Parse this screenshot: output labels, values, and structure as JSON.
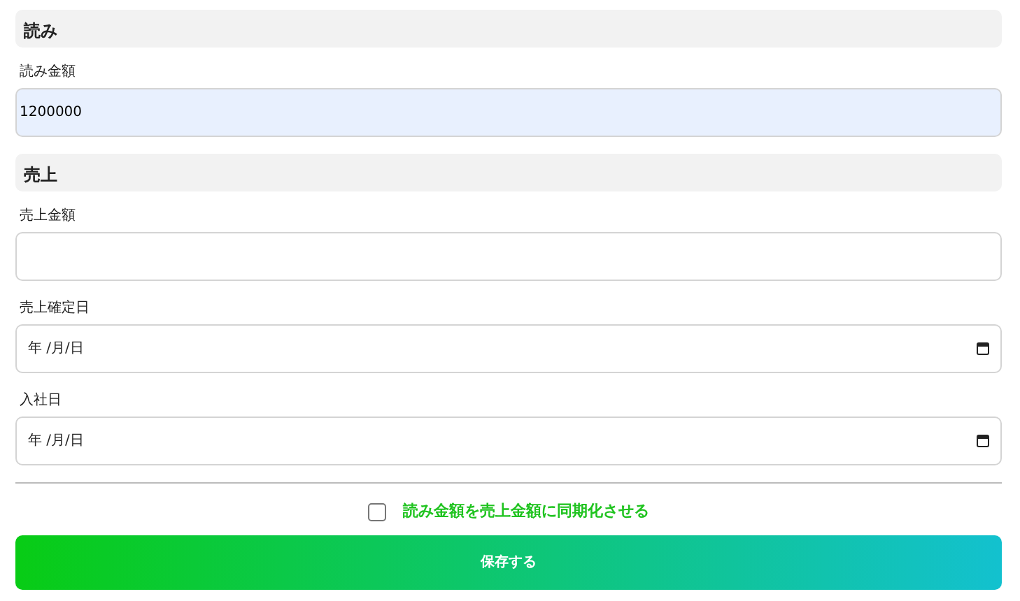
{
  "sections": [
    {
      "title": "読み",
      "fields": [
        {
          "label": "読み金額",
          "kind": "text",
          "value": "1200000",
          "highlighted": true
        }
      ]
    },
    {
      "title": "売上",
      "fields": [
        {
          "label": "売上金額",
          "kind": "text",
          "highlighted": false
        },
        {
          "label": "売上確定日",
          "kind": "date",
          "placeholder": "年 /月/日",
          "highlighted": false
        },
        {
          "label": "入社日",
          "kind": "date",
          "placeholder": "年 /月/日",
          "highlighted": false
        }
      ]
    }
  ],
  "sync": {
    "label": "読み金額を売上金額に同期化させる",
    "checked": false
  },
  "save_button": "保存する"
}
